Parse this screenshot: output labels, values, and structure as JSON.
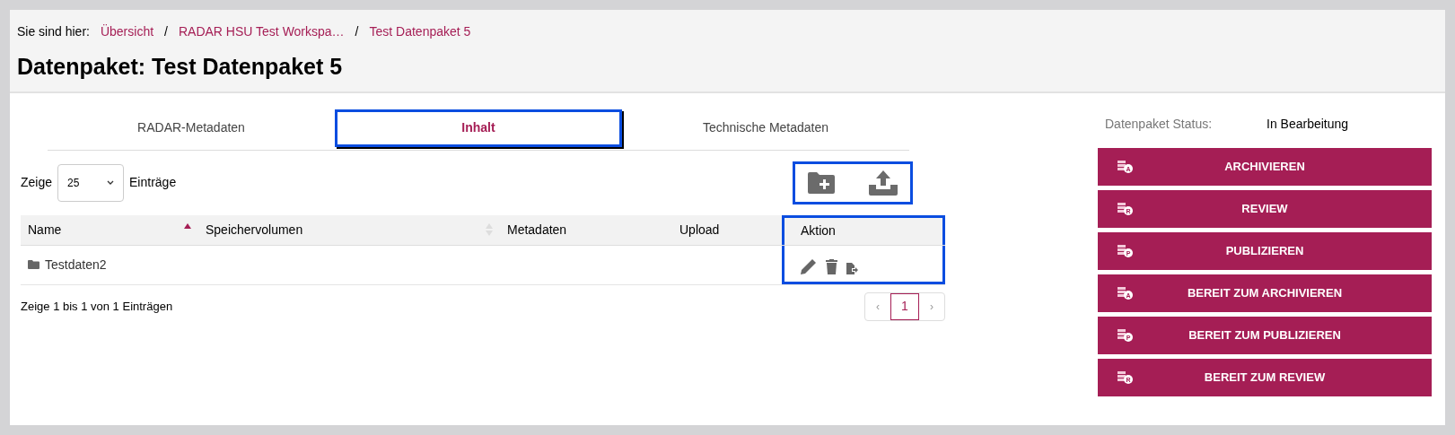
{
  "breadcrumb": {
    "label": "Sie sind hier:",
    "items": [
      "Übersicht",
      "RADAR HSU Test Workspa…",
      "Test Datenpaket 5"
    ],
    "separator": "/"
  },
  "title": "Datenpaket: Test Datenpaket 5",
  "tabs": [
    {
      "label": "RADAR-Metadaten",
      "selected": false,
      "highlighted": false
    },
    {
      "label": "Inhalt",
      "selected": true,
      "highlighted": true
    },
    {
      "label": "Technische Metadaten",
      "selected": false,
      "highlighted": false
    }
  ],
  "length_menu": {
    "before": "Zeige",
    "value": "25",
    "after": "Einträge"
  },
  "toolbar": {
    "highlighted": true,
    "actions": [
      {
        "kind": "new-folder"
      },
      {
        "kind": "upload"
      }
    ]
  },
  "table": {
    "columns": [
      {
        "label": "Name",
        "sorted": true
      },
      {
        "label": "Speichervolumen",
        "sorted": false
      },
      {
        "label": "Metadaten"
      },
      {
        "label": "Upload"
      },
      {
        "label": "Aktion",
        "highlighted": true
      }
    ],
    "rows": [
      {
        "name": "Testdaten2",
        "kind": "folder",
        "actions": [
          {
            "kind": "edit"
          },
          {
            "kind": "delete"
          },
          {
            "kind": "file-export"
          }
        ]
      }
    ]
  },
  "info": "Zeige 1 bis 1 von 1 Einträgen",
  "pagination": {
    "prev": "‹",
    "pages": [
      {
        "label": "1",
        "selected": true
      }
    ],
    "next": "›"
  },
  "status": {
    "label": "Datenpaket Status:",
    "value": "In Bearbeitung"
  },
  "status_buttons": [
    {
      "label": "ARCHIVIEREN",
      "letter": "A"
    },
    {
      "label": "REVIEW",
      "letter": "R"
    },
    {
      "label": "PUBLIZIEREN",
      "letter": "P"
    },
    {
      "label": "BEREIT ZUM ARCHIVIEREN",
      "letter": "A"
    },
    {
      "label": "BEREIT ZUM PUBLIZIEREN",
      "letter": "P"
    },
    {
      "label": "BEREIT ZUM REVIEW",
      "letter": "R"
    }
  ]
}
